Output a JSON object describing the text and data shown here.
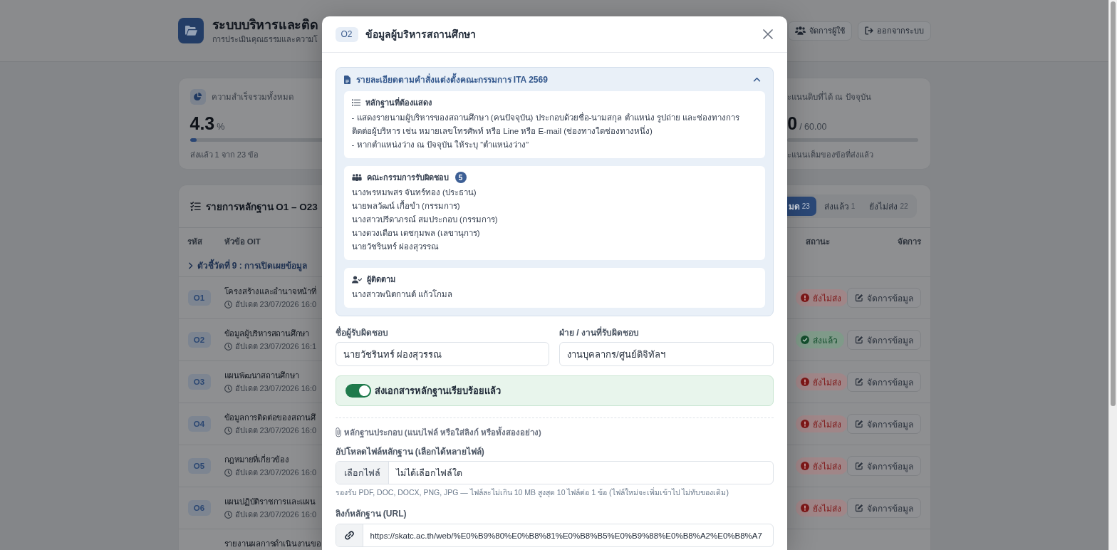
{
  "header": {
    "title": "ระบบบริหารและติด",
    "subtitle": "การประเมินคุณธรรมและความโ",
    "actions": [
      {
        "label": "จัดการผู้ใช้"
      },
      {
        "label": "ออกจากระบบ"
      }
    ]
  },
  "stats": [
    {
      "label": "ความสำเร็จรวมทั้งหมด",
      "value": "4.3",
      "unit": "%",
      "level": 0.043,
      "note": "ส่งแล้ว 1 จาก 23 ข้อ"
    },
    {
      "label": "ะแนนดิบที่ได้ ณ ปัจจุบัน",
      "value": "0",
      "unit": "/ 60.00",
      "note": "ะแนนเต็มของข้อที่ส่งแล้ว"
    }
  ],
  "table": {
    "title": "รายการหลักฐาน O1 – O23",
    "filters": [
      {
        "label": "มด",
        "count": "23",
        "selected": true
      },
      {
        "label": "ส่งแล้ว",
        "count": "1",
        "selected": false
      },
      {
        "label": "ยังไม่ส่ง",
        "count": "22",
        "selected": false
      }
    ],
    "columns": [
      "รหัส",
      "หัวข้อ OIT",
      "สถานะ",
      "จัดการ"
    ],
    "group": "ตัวชี้วัดที่ 9 : การเปิดเผยข้อมูล",
    "rows": [
      {
        "code": "O1",
        "title": "โครงสร้างและอำนาจหน้าที่",
        "updated": "อัปเดต 23/07/2026 16:0",
        "status": "ยังไม่ส่ง",
        "submitted": false,
        "action": "จัดการข้อมูล"
      },
      {
        "code": "O2",
        "title": "ข้อมูลผู้บริหารสถานศึกษา",
        "updated": "อัปเดต 23/07/2026 16:1",
        "status": "ส่งแล้ว",
        "submitted": true,
        "action": "จัดการข้อมูล"
      },
      {
        "code": "O3",
        "title": "แผนพัฒนาสถานศึกษา",
        "updated": "อัปเดต 23/07/2026 16:0",
        "status": "ยังไม่ส่ง",
        "submitted": false,
        "action": "จัดการข้อมูล"
      },
      {
        "code": "O4",
        "title": "ข้อมูลการติดต่อของสถานศึ",
        "updated": "อัปเดต 23/07/2026 16:0",
        "status": "ยังไม่ส่ง",
        "submitted": false,
        "action": "จัดการข้อมูล"
      },
      {
        "code": "O5",
        "title": "กฎหมายที่เกี่ยวข้อง",
        "updated": "อัปเดต 23/07/2026 16:0",
        "status": "ยังไม่ส่ง",
        "submitted": false,
        "action": "จัดการข้อมูล"
      },
      {
        "code": "O6",
        "title": "แผนปฏิบัติราชการและแผน",
        "updated": "อัปเดต 23/07/2026 16:0",
        "status": "ยังไม่ส่ง",
        "submitted": false,
        "action": "จัดการข้อมูล"
      },
      {
        "title": "รายงานผลการดำเนินงานขอ"
      }
    ]
  },
  "dialog": {
    "code": "O2",
    "title": "ข้อมูลผู้บริหารสถานศึกษา",
    "details": {
      "title": "รายละเอียดตามคำสั่งแต่งตั้งคณะกรรมการ ITA 2569",
      "expanded": true,
      "sections": [
        {
          "kind": "requirements",
          "title": "หลักฐานที่ต้องแสดง",
          "lines": [
            "- แสดงรายนามผู้บริหารของสถานศึกษา (คนปัจจุบัน) ประกอบด้วยชื่อ-นามสกุล ตำแหน่ง รูปถ่าย และช่องทางการติดต่อผู้บริหาร เช่น หมายเลขโทรศัพท์ หรือ Line หรือ E-mail (ช่องทางใดช่องทางหนึ่ง)",
            "- หากตำแหน่งว่าง ณ ปัจจุบัน ให้ระบุ “ตำแหน่งว่าง”"
          ]
        },
        {
          "kind": "committee",
          "title": "คณะกรรมการรับผิดชอบ",
          "count": "5",
          "lines": [
            "นางพรหมพสร จันทร์ทอง (ประธาน)",
            "นายพลวัฒน์ เกื้อขำ (กรรมการ)",
            "นางสาวปรีดาภรณ์ สมประกอบ (กรรมการ)",
            "นางดวงเดือน เดชกุมพล (เลขานุการ)",
            "นายวัชรินทร์ ผ่องสุวรรณ"
          ]
        },
        {
          "kind": "follower",
          "title": "ผู้ติดตาม",
          "lines": [
            "นางสาวพนิตกานต์ แก้วโกมล"
          ]
        }
      ]
    },
    "fields": [
      {
        "label": "ชื่อผู้รับผิดชอบ",
        "value": "นายวัชรินทร์ ผ่องสุวรรณ"
      },
      {
        "label": "ฝ่าย / งานที่รับผิดชอบ",
        "value": "งานบุคลากร/ศูนย์ดิจิทัลฯ"
      }
    ],
    "submitted_switch": {
      "label": "ส่งเอกสารหลักฐานเรียบร้อยแล้ว",
      "on": true
    },
    "attachments": {
      "title": "หลักฐานประกอบ (แนบไฟล์ หรือใส่ลิงก์ หรือทั้งสองอย่าง)",
      "upload_label": "อัปโหลดไฟล์หลักฐาน (เลือกได้หลายไฟล์)",
      "file_button": "เลือกไฟล์",
      "file_status": "ไม่ได้เลือกไฟล์ใด",
      "hint": "รองรับ PDF, DOC, DOCX, PNG, JPG — ไฟล์ละไม่เกิน 10 MB สูงสุด 10 ไฟล์ต่อ 1 ข้อ (ไฟล์ใหม่จะเพิ่มเข้าไป ไม่ทับของเดิม)",
      "link_label": "ลิงก์หลักฐาน (URL)",
      "link_value": "https://skatc.ac.th/web/%E0%B9%80%E0%B8%81%E0%B8%B5%E0%B9%88%E0%B8%A2%E0%B8%A7"
    }
  }
}
